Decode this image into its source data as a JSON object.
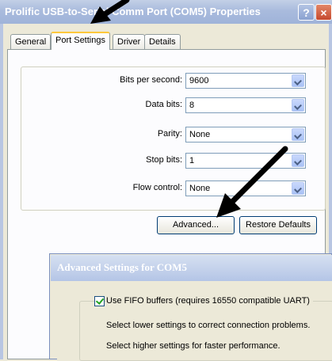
{
  "window": {
    "title": "Prolific USB-to-Serial Comm Port (COM5) Properties",
    "help_label": "?",
    "close_label": "×"
  },
  "tabs": [
    {
      "label": "General"
    },
    {
      "label": "Port Settings"
    },
    {
      "label": "Driver"
    },
    {
      "label": "Details"
    }
  ],
  "settings": [
    {
      "label": "Bits per second:",
      "value": "9600"
    },
    {
      "label": "Data bits:",
      "value": "8"
    },
    {
      "label": "Parity:",
      "value": "None"
    },
    {
      "label": "Stop bits:",
      "value": "1"
    },
    {
      "label": "Flow control:",
      "value": "None"
    }
  ],
  "buttons": {
    "advanced": "Advanced...",
    "restore_defaults": "Restore Defaults"
  },
  "advanced_window": {
    "title": "Advanced Settings for COM5",
    "fifo_label": "Use FIFO buffers (requires 16550 compatible UART)",
    "fifo_checked": true,
    "hint_lower": "Select lower settings to correct connection problems.",
    "hint_higher": "Select higher settings for faster performance."
  },
  "colors": {
    "title_bar": "#a9bbdd",
    "close_button": "#c64a2e",
    "active_tab_accent": "#ffc83c",
    "annotation_arrow": "#000000"
  }
}
